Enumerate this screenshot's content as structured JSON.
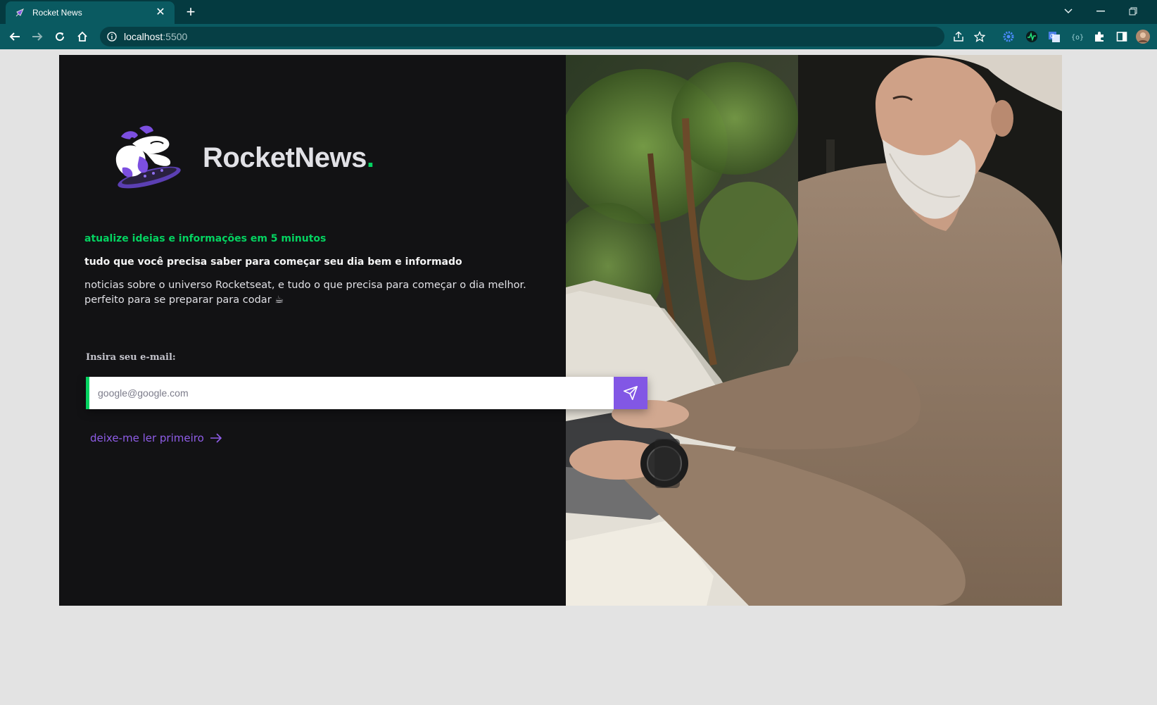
{
  "browser": {
    "tab_title": "Rocket News",
    "tab_close": "✕",
    "new_tab": "+",
    "url_host": "localhost",
    "url_port": ":5500",
    "chrome_color": "#0a5a61"
  },
  "page": {
    "brand_name": "RocketNews",
    "brand_dot": ".",
    "tagline": "atualize ideias e informações em 5 minutos",
    "subtitle": "tudo que você precisa saber para começar seu dia bem e informado",
    "description_line1": "noticias sobre o universo Rocketseat, e tudo o que precisa para começar o dia melhor.",
    "description_line2": "perfeito para se preparar para codar ☕",
    "email_label": "Insira seu e-mail:",
    "email_placeholder": "google@google.com",
    "email_value": "",
    "read_first_label": "deixe-me ler primeiro",
    "colors": {
      "background": "#121214",
      "accent_green": "#04d361",
      "accent_purple": "#8257e5"
    },
    "hero_image": "man-with-beard-typing-on-laptop"
  }
}
